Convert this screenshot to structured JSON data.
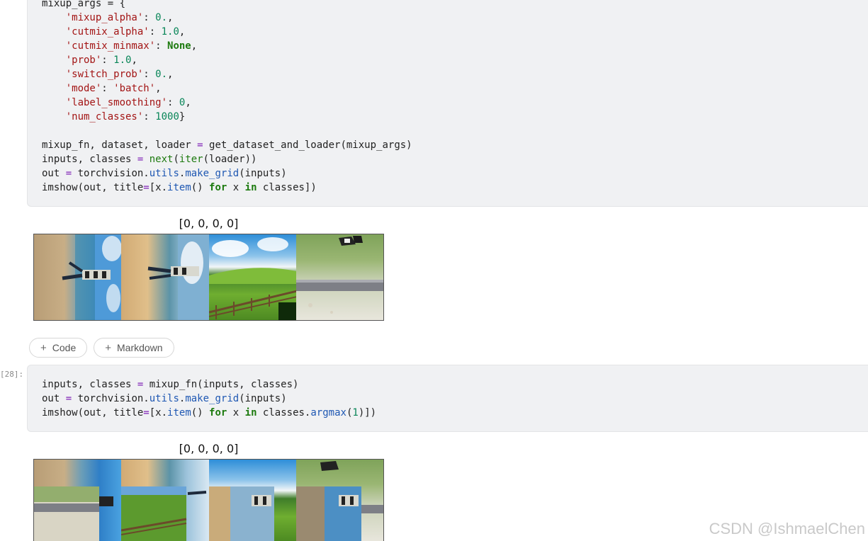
{
  "cells": [
    {
      "code_lines": [
        "mixup_args = {",
        "    'mixup_alpha': 0.,",
        "    'cutmix_alpha': 1.0,",
        "    'cutmix_minmax': None,",
        "    'prob': 1.0,",
        "    'switch_prob': 0.,",
        "    'mode': 'batch',",
        "    'label_smoothing': 0,",
        "    'num_classes': 1000}",
        "",
        "mixup_fn, dataset, loader = get_dataset_and_loader(mixup_args)",
        "inputs, classes = next(iter(loader))",
        "out = torchvision.utils.make_grid(inputs)",
        "imshow(out, title=[x.item() for x in classes])"
      ],
      "output_title": "[0, 0, 0, 0]"
    },
    {
      "exec_count": "[28]:",
      "code_lines": [
        "inputs, classes = mixup_fn(inputs, classes)",
        "out = torchvision.utils.make_grid(inputs)",
        "imshow(out, title=[x.item() for x in classes.argmax(1)])"
      ],
      "output_title": "[0, 0, 0, 0]"
    }
  ],
  "add_bar": {
    "code_label": "Code",
    "markdown_label": "Markdown",
    "plus_icon": "plus-icon"
  },
  "watermark": "CSDN @IshmaelChen",
  "colors": {
    "string": "#a31515",
    "number": "#098658",
    "keyword": "#1d7a0f",
    "operator": "#7d1fb5",
    "attribute": "#1f58b3",
    "cell_bg": "#f0f1f3"
  }
}
